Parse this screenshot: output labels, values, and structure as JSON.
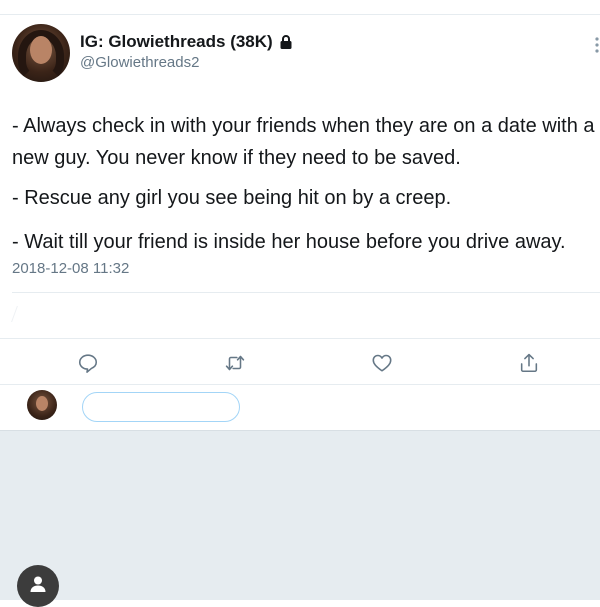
{
  "tweet": {
    "display_name": "IG: Glowiethreads (38K)",
    "handle": "@Glowiethreads2",
    "lines": [
      "- Always check in with your friends when they are on a date with a new guy. You never know if they need to be saved.",
      "- Rescue any girl you see being hit on by a creep.",
      "- Wait till your friend is inside her house before you drive away."
    ],
    "timestamp": "2018-12-08 11:32"
  },
  "actions": {
    "reply_icon": "reply-icon",
    "retweet_icon": "retweet-icon",
    "like_icon": "heart-icon",
    "share_icon": "share-icon"
  },
  "reply_box": {
    "placeholder": "",
    "value": ""
  },
  "colors": {
    "text": "#14171a",
    "muted": "#657786",
    "divider": "#e6ecf0",
    "icon": "#657786",
    "input_border": "#a3d5f7",
    "bottom_bg": "#e6ecf0"
  }
}
